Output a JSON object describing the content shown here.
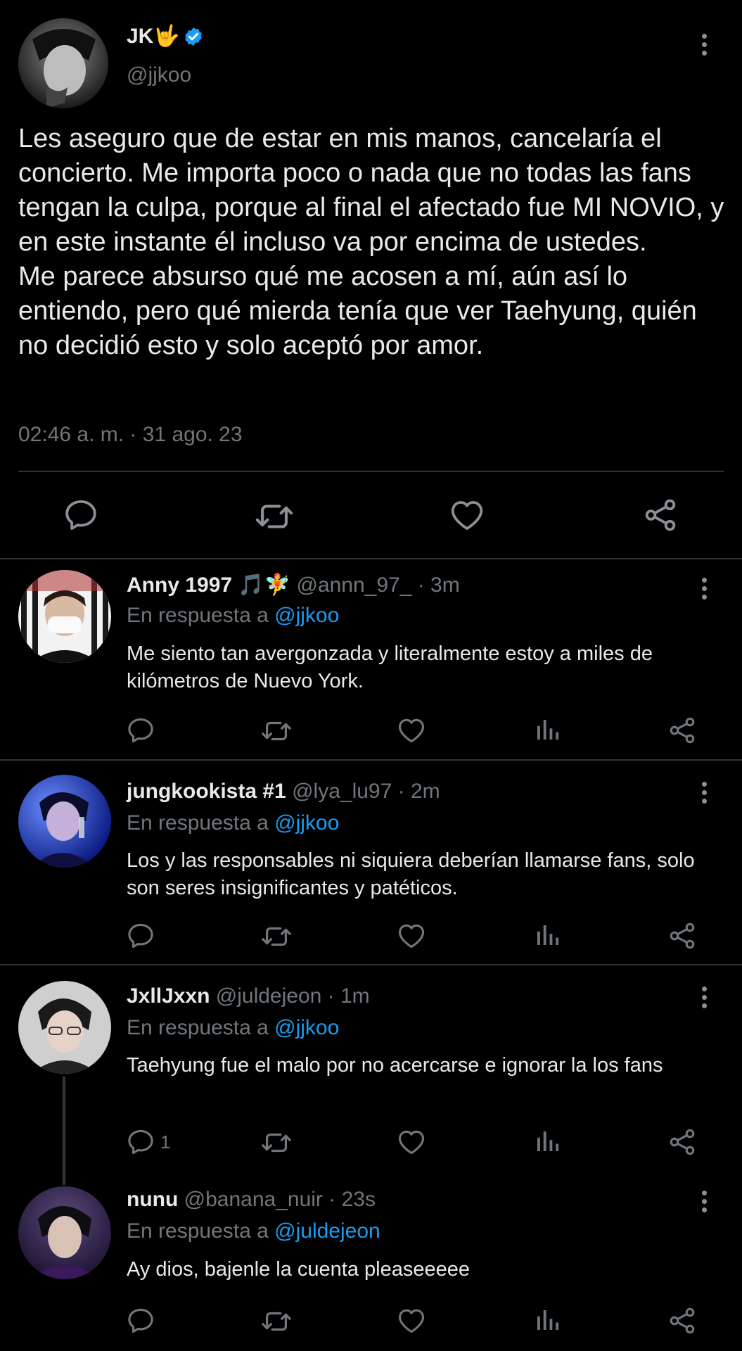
{
  "main_tweet": {
    "display_name": "JK🤟",
    "handle": "@jjkoo",
    "text": "Les aseguro que de estar en mis manos, cancelaría el concierto. Me importa poco o nada que no todas las fans tengan la culpa, porque al final el afectado fue MI NOVIO, y en este instante él incluso va por encima de ustedes.\nMe parece absurso qué me acosen a mí, aún así lo entiendo, pero qué mierda tenía que ver Taehyung, quién no decidió esto y solo aceptó por amor.",
    "timestamp": "02:46 a. m. · 31 ago. 23",
    "verified": true
  },
  "replies": [
    {
      "display_name": "Anny 1997 🎵🧚",
      "meta": "@annn_97_ · 3m",
      "in_reply_prefix": "En respuesta a",
      "in_reply_to": "@jjkoo",
      "text": "Me siento tan avergonzada y literalmente estoy a miles de kilómetros de Nuevo York.",
      "reply_count": ""
    },
    {
      "display_name": "jungkookista #1",
      "meta": "@lya_lu97 · 2m",
      "in_reply_prefix": "En respuesta a",
      "in_reply_to": "@jjkoo",
      "text": "Los y las responsables ni siquiera deberían llamarse fans, solo son seres insignificantes y patéticos.",
      "reply_count": ""
    },
    {
      "display_name": "JxllJxxn",
      "meta": "@juldejeon · 1m",
      "in_reply_prefix": "En respuesta a",
      "in_reply_to": "@jjkoo",
      "text": "Taehyung fue el malo por no acercarse e ignorar la los fans",
      "reply_count": "1"
    },
    {
      "display_name": "nunu",
      "meta": "@banana_nuir · 23s",
      "in_reply_prefix": "En respuesta a",
      "in_reply_to": "@juldejeon",
      "text": "Ay dios, bajenle la cuenta pleaseeeee",
      "reply_count": ""
    }
  ],
  "colors": {
    "background": "#000000",
    "text": "#e7e9ea",
    "secondary": "#71767b",
    "link": "#1d9bf0",
    "divider": "#2f3336",
    "verified": "#1d9bf0"
  },
  "icons": [
    "reply-icon",
    "retweet-icon",
    "like-icon",
    "share-icon",
    "views-icon",
    "more-icon",
    "verified-badge-icon"
  ]
}
